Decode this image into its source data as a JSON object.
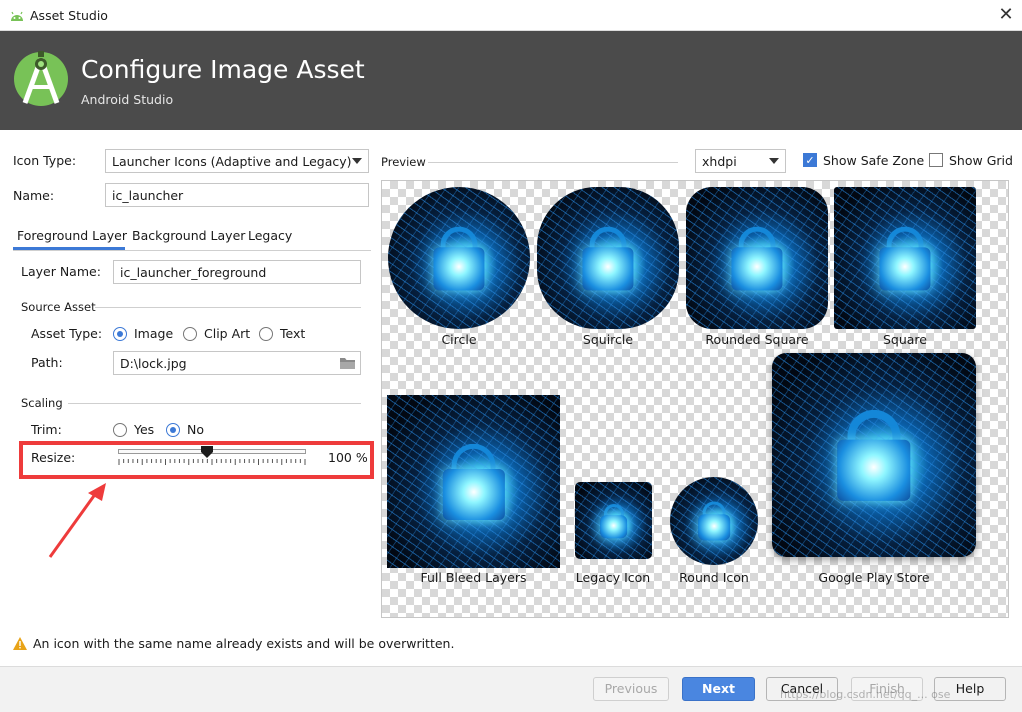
{
  "window": {
    "title": "Asset Studio",
    "close_glyph": "✕"
  },
  "header": {
    "title": "Configure Image Asset",
    "subtitle": "Android Studio"
  },
  "form": {
    "icon_type_label": "Icon Type:",
    "icon_type_value": "Launcher Icons (Adaptive and Legacy)",
    "name_label": "Name:",
    "name_value": "ic_launcher"
  },
  "tabs": [
    {
      "label": "Foreground Layer",
      "selected": true
    },
    {
      "label": "Background Layer",
      "selected": false
    },
    {
      "label": "Legacy",
      "selected": false
    }
  ],
  "foreground": {
    "layer_name_label": "Layer Name:",
    "layer_name_value": "ic_launcher_foreground",
    "source_asset_heading": "Source Asset",
    "asset_type_label": "Asset Type:",
    "asset_type_options": [
      "Image",
      "Clip Art",
      "Text"
    ],
    "asset_type_selected": "Image",
    "path_label": "Path:",
    "path_value": "D:\\lock.jpg",
    "scaling_heading": "Scaling",
    "trim_label": "Trim:",
    "trim_options": [
      "Yes",
      "No"
    ],
    "trim_selected": "No",
    "resize_label": "Resize:",
    "resize_value_text": "100 %",
    "resize_percent": 100
  },
  "preview": {
    "label": "Preview",
    "density_value": "xhdpi",
    "show_safe_zone_label": "Show Safe Zone",
    "show_safe_zone_checked": true,
    "show_grid_label": "Show Grid",
    "show_grid_checked": false,
    "shapes": [
      "Circle",
      "Squircle",
      "Rounded Square",
      "Square",
      "Full Bleed Layers",
      "Legacy Icon",
      "Round Icon",
      "Google Play Store"
    ]
  },
  "warning": {
    "icon": "warning-triangle-icon",
    "text": "An icon with the same name already exists and will be overwritten."
  },
  "buttons": {
    "previous": "Previous",
    "next": "Next",
    "cancel": "Cancel",
    "finish": "Finish",
    "help": "Help"
  },
  "watermark": "https://blog.csdn.net/qq_... ose",
  "colors": {
    "header_bg": "#4b4b4b",
    "accent": "#3c79d6",
    "highlight": "#ee3b3b",
    "android_green": "#78c257"
  }
}
